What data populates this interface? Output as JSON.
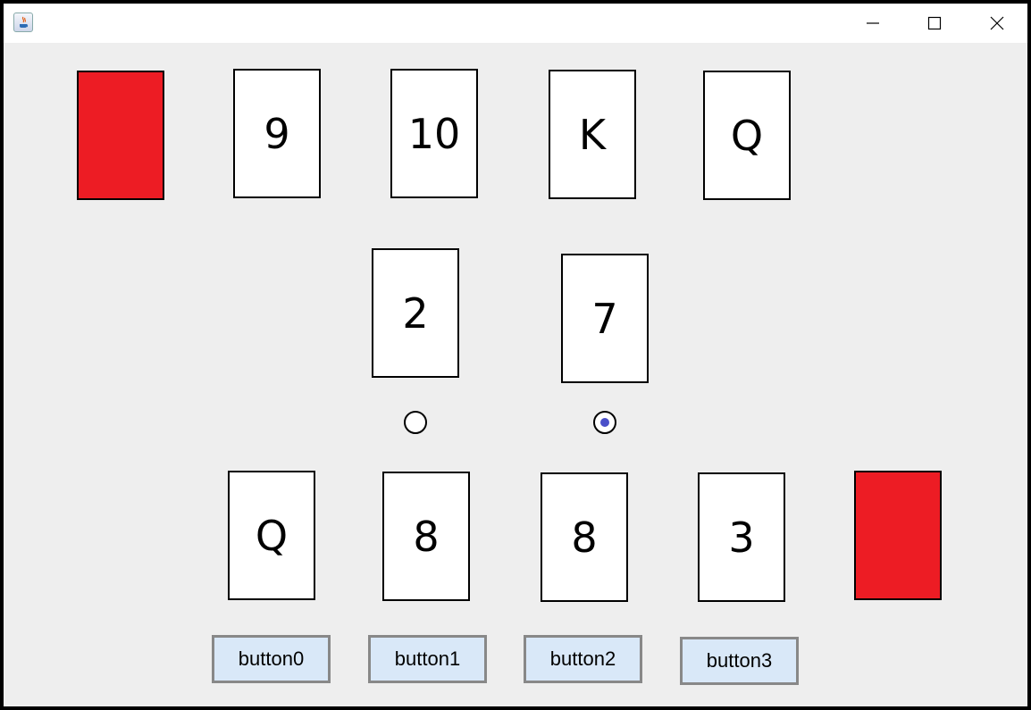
{
  "window": {
    "title": "",
    "controls": [
      "minimize-icon",
      "maximize-icon",
      "close-icon"
    ]
  },
  "colors": {
    "card_back": "#ed1c24",
    "card_face": "#ffffff",
    "background": "#eeeeee",
    "button_bg": "#d9e8f8",
    "radio_selected": "#4a4fc9"
  },
  "opponent": {
    "cards": [
      "9",
      "10",
      "K",
      "Q"
    ]
  },
  "table": {
    "cards": [
      "2",
      "7"
    ],
    "selected_index": 1
  },
  "player": {
    "cards": [
      "Q",
      "8",
      "8",
      "3"
    ],
    "buttons": [
      "button0",
      "button1",
      "button2",
      "button3"
    ]
  }
}
